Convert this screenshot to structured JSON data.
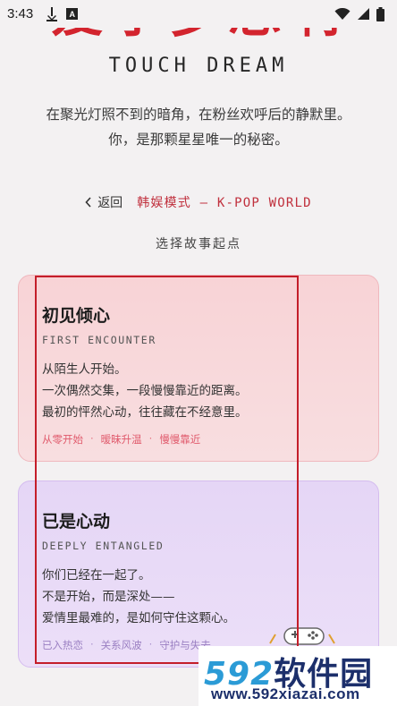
{
  "status_bar": {
    "time": "3:43",
    "icons": [
      "download-icon",
      "a-icon",
      "wifi-icon",
      "signal-icon",
      "battery-icon"
    ]
  },
  "header": {
    "title_cn": "爱予梦想啊",
    "title_en": "TOUCH DREAM",
    "intro_line1": "在聚光灯照不到的暗角，在粉丝欢呼后的静默里。",
    "intro_line2": "你，是那颗星星唯一的秘密。"
  },
  "nav": {
    "back_label": "返回",
    "mode_label": "韩娱模式 — K-POP WORLD"
  },
  "section_label": "选择故事起点",
  "cards": [
    {
      "title": "初见倾心",
      "subtitle_en": "FIRST ENCOUNTER",
      "desc": [
        "从陌生人开始。",
        "一次偶然交集，一段慢慢靠近的距离。",
        "最初的怦然心动，往往藏在不经意里。"
      ],
      "tags": [
        "从零开始",
        "暧昧升温",
        "慢慢靠近"
      ]
    },
    {
      "title": "已是心动",
      "subtitle_en": "DEEPLY ENTANGLED",
      "desc": [
        "你们已经在一起了。",
        "不是开始，而是深处——",
        "爱情里最难的，是如何守住这颗心。"
      ],
      "tags": [
        "已入热恋",
        "关系风波",
        "守护与失去"
      ]
    }
  ],
  "watermark": {
    "num": "592",
    "cn": "软件园",
    "url": "www.592xiazai.com"
  },
  "colors": {
    "accent_red": "#d3242e",
    "pink_card": "#f8d3d6",
    "purple_card": "#e5d6f6"
  }
}
